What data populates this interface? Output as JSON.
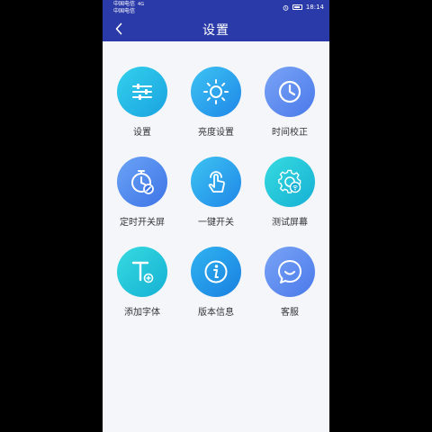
{
  "status_bar": {
    "carrier_1": "中国电信",
    "carrier_2": "中国电信",
    "network": "4G",
    "time": "18:14"
  },
  "header": {
    "title": "设置"
  },
  "grid": [
    {
      "label": "设置",
      "icon": "sliders-icon",
      "color": "#1fb5e0"
    },
    {
      "label": "亮度设置",
      "icon": "sun-icon",
      "color": "#2aa6ec"
    },
    {
      "label": "时间校正",
      "icon": "clock-icon",
      "color": "#5a8ff2"
    },
    {
      "label": "定时开关屏",
      "icon": "timer-icon",
      "color": "#4b8ff0"
    },
    {
      "label": "一键开关",
      "icon": "tap-icon",
      "color": "#2ba9ec"
    },
    {
      "label": "测试屏幕",
      "icon": "test-gear-icon",
      "color": "#1fc2dc"
    },
    {
      "label": "添加字体",
      "icon": "add-font-icon",
      "color": "#1ec0da"
    },
    {
      "label": "版本信息",
      "icon": "info-icon",
      "color": "#2196e6"
    },
    {
      "label": "客服",
      "icon": "chat-icon",
      "color": "#5a8ff2"
    }
  ]
}
